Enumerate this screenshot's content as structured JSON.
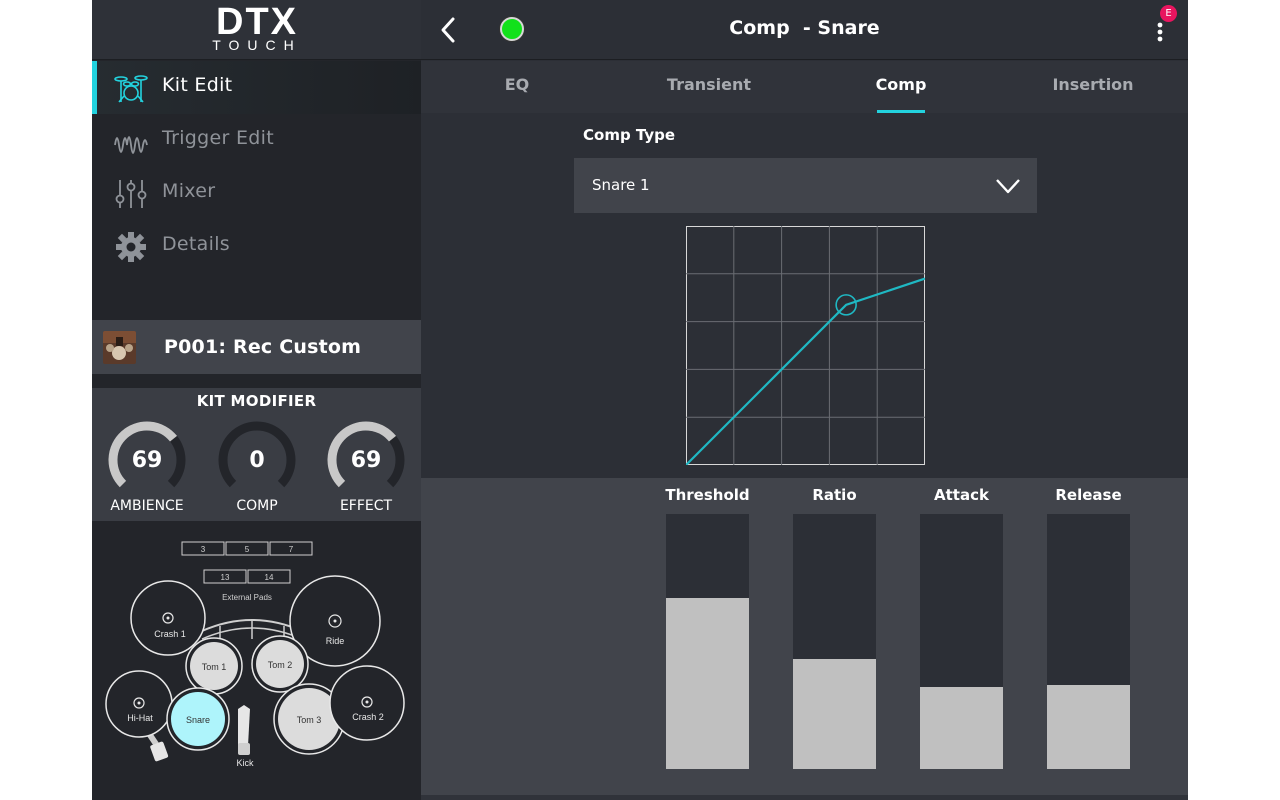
{
  "app": {
    "logo_main": "DTX",
    "logo_sub": "TOUCH"
  },
  "sidebar": {
    "items": [
      {
        "label": "Kit Edit",
        "icon": "drum-kit-icon",
        "active": true
      },
      {
        "label": "Trigger Edit",
        "icon": "waveform-icon",
        "active": false
      },
      {
        "label": "Mixer",
        "icon": "mixer-sliders-icon",
        "active": false
      },
      {
        "label": "Details",
        "icon": "gear-icon",
        "active": false
      }
    ],
    "kit": {
      "name": "P001: Rec Custom"
    },
    "kit_modifier": {
      "title": "KIT MODIFIER",
      "knobs": [
        {
          "label": "AMBIENCE",
          "value": "69",
          "level": 0.69
        },
        {
          "label": "COMP",
          "value": "0",
          "level": 0
        },
        {
          "label": "EFFECT",
          "value": "69",
          "level": 0.69
        }
      ]
    },
    "pads": {
      "external_boxes_row1": [
        "3",
        "5",
        "7"
      ],
      "external_boxes_row2": [
        "13",
        "14"
      ],
      "external_label": "External Pads",
      "drums": [
        "Crash 1",
        "Ride",
        "Tom 1",
        "Tom 2",
        "Hi-Hat",
        "Snare",
        "Tom 3",
        "Crash 2",
        "Kick"
      ],
      "selected": "Snare"
    }
  },
  "topbar": {
    "title": "Comp  - Snare",
    "badge": "E",
    "status_color": "#12e11b"
  },
  "tabs": [
    {
      "label": "EQ",
      "active": false
    },
    {
      "label": "Transient",
      "active": false
    },
    {
      "label": "Comp",
      "active": true
    },
    {
      "label": "Insertion",
      "active": false
    }
  ],
  "comp": {
    "type_label": "Comp Type",
    "type_value": "Snare 1",
    "curve": {
      "threshold_x": 0.67,
      "threshold_y": 0.67,
      "end_y": 0.78
    }
  },
  "sliders": [
    {
      "label": "Threshold",
      "level": 0.67
    },
    {
      "label": "Ratio",
      "level": 0.43
    },
    {
      "label": "Attack",
      "level": 0.32
    },
    {
      "label": "Release",
      "level": 0.33
    }
  ],
  "colors": {
    "accent": "#23d3df",
    "selected_pad": "#aef4fb",
    "badge": "#e8155f"
  }
}
